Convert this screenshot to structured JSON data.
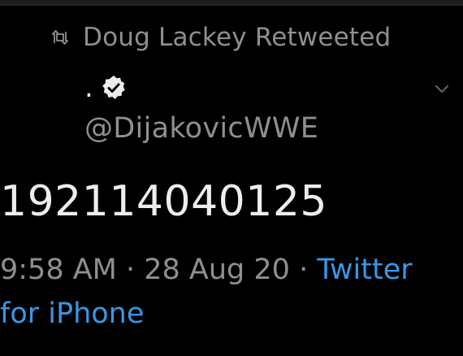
{
  "social_context": {
    "icon": "retweet-icon",
    "text": "Doug Lackey Retweeted"
  },
  "author": {
    "display_name": ".",
    "verified_icon": "verified-badge-icon",
    "handle": "@DijakovicWWE"
  },
  "menu": {
    "icon": "chevron-down-icon"
  },
  "tweet": {
    "text": "192114040125"
  },
  "meta": {
    "time": "9:58 AM",
    "separator": " · ",
    "date": "28 Aug 20",
    "source": "Twitter for iPhone"
  },
  "colors": {
    "background": "#000000",
    "primary_text": "#e7e7e7",
    "secondary_text": "#8e8f92",
    "link": "#3a97e3"
  }
}
